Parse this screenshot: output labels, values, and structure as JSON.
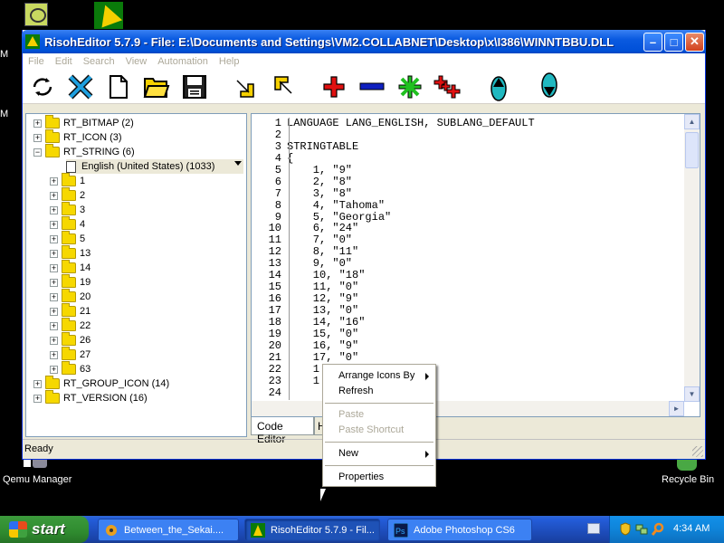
{
  "desktop": {
    "icon_letter_1": "M",
    "icon_letter_2": "M",
    "qemu_label": "Qemu Manager",
    "recycle_label": "Recycle Bin"
  },
  "window": {
    "title": "RisohEditor 5.7.9 - File: E:\\Documents and Settings\\VM2.COLLABNET\\Desktop\\x\\I386\\WINNTBBU.DLL",
    "minimize": "–",
    "maximize": "□",
    "close": "✕"
  },
  "menu": [
    "File",
    "Edit",
    "Search",
    "View",
    "Automation",
    "Help"
  ],
  "toolbar": [
    "refresh-icon",
    "cancel-icon",
    "new-file-icon",
    "open-folder-icon",
    "save-icon",
    "import-icon",
    "export-icon",
    "add-icon",
    "remove-icon",
    "modify-icon",
    "add-multiple-icon",
    "move-up-icon",
    "move-down-icon"
  ],
  "tree": {
    "top_items": [
      {
        "label": "RT_BITMAP (2)",
        "expander": "+"
      },
      {
        "label": "RT_ICON (3)",
        "expander": "+"
      },
      {
        "label": "RT_STRING (6)",
        "expander": "−"
      }
    ],
    "language_item": "English (United States) (1033)",
    "string_children": [
      "1",
      "2",
      "3",
      "4",
      "5",
      "13",
      "14",
      "19",
      "20",
      "21",
      "22",
      "26",
      "27",
      "63"
    ],
    "bottom_items": [
      {
        "label": "RT_GROUP_ICON (14)",
        "expander": "+"
      },
      {
        "label": "RT_VERSION (16)",
        "expander": "+"
      }
    ]
  },
  "editor": {
    "lines": [
      {
        "n": "1",
        "t": "LANGUAGE LANG_ENGLISH, SUBLANG_DEFAULT"
      },
      {
        "n": "2",
        "t": ""
      },
      {
        "n": "3",
        "t": "STRINGTABLE"
      },
      {
        "n": "4",
        "t": "{"
      },
      {
        "n": "5",
        "t": "    1, \"9\""
      },
      {
        "n": "6",
        "t": "    2, \"8\""
      },
      {
        "n": "7",
        "t": "    3, \"8\""
      },
      {
        "n": "8",
        "t": "    4, \"Tahoma\""
      },
      {
        "n": "9",
        "t": "    5, \"Georgia\""
      },
      {
        "n": "10",
        "t": "    6, \"24\""
      },
      {
        "n": "11",
        "t": "    7, \"0\""
      },
      {
        "n": "12",
        "t": "    8, \"11\""
      },
      {
        "n": "13",
        "t": "    9, \"0\""
      },
      {
        "n": "14",
        "t": "    10, \"18\""
      },
      {
        "n": "15",
        "t": "    11, \"0\""
      },
      {
        "n": "16",
        "t": "    12, \"9\""
      },
      {
        "n": "17",
        "t": "    13, \"0\""
      },
      {
        "n": "18",
        "t": "    14, \"16\""
      },
      {
        "n": "19",
        "t": "    15, \"0\""
      },
      {
        "n": "20",
        "t": "    16, \"9\""
      },
      {
        "n": "21",
        "t": "    17, \"0\""
      },
      {
        "n": "22",
        "t": "    1"
      },
      {
        "n": "23",
        "t": "    1"
      },
      {
        "n": "24",
        "t": ""
      }
    ],
    "tab_code_editor": "Code Editor",
    "tab_second": "H"
  },
  "status": {
    "text": "Ready"
  },
  "context_menu": {
    "arrange_icons_by": "Arrange Icons By",
    "refresh": "Refresh",
    "paste": "Paste",
    "paste_shortcut": "Paste Shortcut",
    "new": "New",
    "properties": "Properties"
  },
  "taskbar": {
    "start": "start",
    "tasks": [
      "Between_the_Sekai....",
      "RisohEditor 5.7.9 - Fil...",
      "Adobe Photoshop CS6"
    ],
    "clock": "4:34 AM"
  },
  "colors": {
    "titlebar": "#0a5ae0",
    "taskbar": "#245edb",
    "start_green": "#3c9a3c",
    "tray": "#0f84d9"
  }
}
